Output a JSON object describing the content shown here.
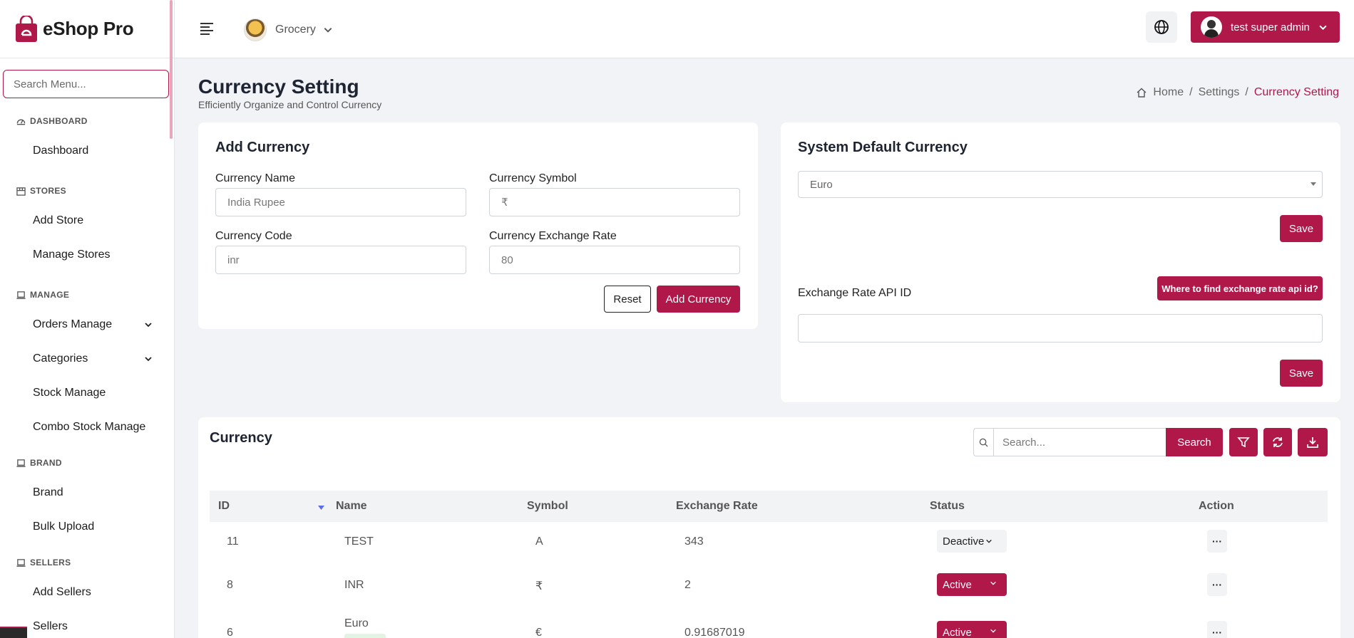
{
  "brand": {
    "name": "eShop Pro",
    "accent": "#b1184a"
  },
  "sidebar": {
    "search_placeholder": "Search Menu...",
    "sections": [
      {
        "title": "DASHBOARD",
        "icon": "gauge-icon",
        "items": [
          {
            "label": "Dashboard"
          }
        ]
      },
      {
        "title": "STORES",
        "icon": "store-icon",
        "items": [
          {
            "label": "Add Store"
          },
          {
            "label": "Manage Stores"
          }
        ]
      },
      {
        "title": "MANAGE",
        "icon": "laptop-icon",
        "items": [
          {
            "label": "Orders Manage",
            "expandable": true
          },
          {
            "label": "Categories",
            "expandable": true
          },
          {
            "label": "Stock Manage"
          },
          {
            "label": "Combo Stock Manage"
          }
        ]
      },
      {
        "title": "BRAND",
        "icon": "laptop-icon",
        "items": [
          {
            "label": "Brand"
          },
          {
            "label": "Bulk Upload"
          }
        ]
      },
      {
        "title": "SELLERS",
        "icon": "laptop-icon",
        "items": [
          {
            "label": "Add Sellers"
          },
          {
            "label": "Sellers"
          }
        ]
      }
    ]
  },
  "header": {
    "store": "Grocery",
    "user": "test super admin"
  },
  "page": {
    "title": "Currency Setting",
    "subtitle": "Efficiently Organize and Control Currency",
    "breadcrumb": {
      "home": "Home",
      "settings": "Settings",
      "current": "Currency Setting",
      "sep": "/"
    }
  },
  "add_currency": {
    "title": "Add Currency",
    "name_label": "Currency Name",
    "name_placeholder": "India Rupee",
    "symbol_label": "Currency Symbol",
    "symbol_placeholder": "₹",
    "code_label": "Currency Code",
    "code_placeholder": "inr",
    "rate_label": "Currency Exchange Rate",
    "rate_placeholder": "80",
    "reset": "Reset",
    "submit": "Add Currency"
  },
  "system_default": {
    "title": "System Default Currency",
    "selected": "Euro",
    "save": "Save",
    "api_label": "Exchange Rate API ID",
    "api_help": "Where to find exchange rate api id?",
    "api_value": "",
    "save2": "Save"
  },
  "currency_table": {
    "title": "Currency",
    "search_placeholder": "Search...",
    "search_btn": "Search",
    "columns": {
      "id": "ID",
      "name": "Name",
      "symbol": "Symbol",
      "rate": "Exchange Rate",
      "status": "Status",
      "action": "Action"
    },
    "rows": [
      {
        "id": "11",
        "name": "TEST",
        "symbol": "A",
        "rate": "343",
        "status": "Deactive"
      },
      {
        "id": "8",
        "name": "INR",
        "symbol": "₹",
        "rate": "2",
        "status": "Active"
      },
      {
        "id": "6",
        "name": "Euro",
        "symbol": "€",
        "rate": "0.91687019",
        "status": "Active"
      }
    ]
  }
}
